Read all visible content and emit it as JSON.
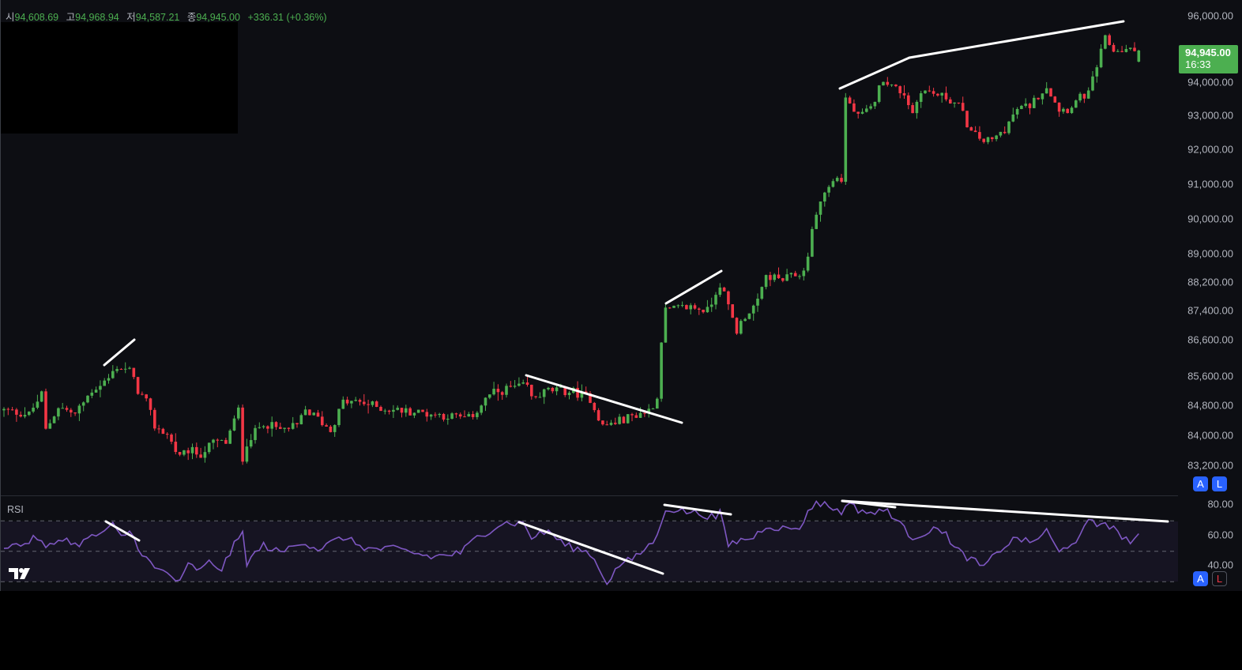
{
  "legend": {
    "open_label": "시",
    "open": "94,608.69",
    "high_label": "고",
    "high": "94,968.94",
    "low_label": "저",
    "low": "94,587.21",
    "close_label": "종",
    "close": "94,945.00",
    "change": "+336.31 (+0.36%)"
  },
  "last_price": {
    "price": "94,945.00",
    "countdown": "16:33"
  },
  "buttons": {
    "auto": "A",
    "log": "L"
  },
  "rsi_title": "RSI",
  "colors": {
    "up": "#4caf50",
    "down": "#f23645",
    "rsi": "#7e57c2",
    "background": "#0d0e13"
  },
  "chart_data": [
    {
      "type": "candlestick",
      "title": "",
      "scale": "log",
      "ylim": [
        83000,
        96200
      ],
      "price_ticks": [
        "96,000.00",
        "94,000.00",
        "93,000.00",
        "92,000.00",
        "91,000.00",
        "90,000.00",
        "89,000.00",
        "88,200.00",
        "87,400.00",
        "86,600.00",
        "85,600.00",
        "84,800.00",
        "84,000.00",
        "83,200.00"
      ],
      "price_tick_values": [
        96000,
        94000,
        93000,
        92000,
        91000,
        90000,
        89000,
        88200,
        87400,
        86600,
        85600,
        84800,
        84000,
        83200
      ],
      "bar_count": 272,
      "last_bar": {
        "open": 94608.69,
        "high": 94968.94,
        "low": 94587.21,
        "close": 94945.0
      },
      "close_path": [
        [
          0,
          84670
        ],
        [
          6,
          84560
        ],
        [
          9,
          85100
        ],
        [
          10,
          84130
        ],
        [
          13,
          84780
        ],
        [
          17,
          84560
        ],
        [
          21,
          85210
        ],
        [
          25,
          85535
        ],
        [
          27,
          85860
        ],
        [
          30,
          85750
        ],
        [
          32,
          85210
        ],
        [
          34,
          84890
        ],
        [
          36,
          84240
        ],
        [
          39,
          84020
        ],
        [
          42,
          83390
        ],
        [
          44,
          83600
        ],
        [
          47,
          83500
        ],
        [
          50,
          83810
        ],
        [
          53,
          83810
        ],
        [
          56,
          84670
        ],
        [
          57,
          83390
        ],
        [
          58,
          83810
        ],
        [
          62,
          84350
        ],
        [
          66,
          84130
        ],
        [
          70,
          84240
        ],
        [
          72,
          84670
        ],
        [
          75,
          84450
        ],
        [
          78,
          84130
        ],
        [
          81,
          84890
        ],
        [
          85,
          84890
        ],
        [
          91,
          84710
        ],
        [
          98,
          84630
        ],
        [
          106,
          84520
        ],
        [
          111,
          84450
        ],
        [
          113,
          84670
        ],
        [
          116,
          85100
        ],
        [
          121,
          85275
        ],
        [
          125,
          85320
        ],
        [
          126,
          84990
        ],
        [
          130,
          85210
        ],
        [
          136,
          85170
        ],
        [
          140,
          84990
        ],
        [
          143,
          84240
        ],
        [
          146,
          84350
        ],
        [
          151,
          84560
        ],
        [
          154,
          84670
        ],
        [
          156,
          84990
        ],
        [
          157,
          86620
        ],
        [
          158,
          87400
        ],
        [
          164,
          87510
        ],
        [
          168,
          87400
        ],
        [
          171,
          88160
        ],
        [
          173,
          87510
        ],
        [
          175,
          86840
        ],
        [
          177,
          87270
        ],
        [
          180,
          87620
        ],
        [
          182,
          88370
        ],
        [
          186,
          88260
        ],
        [
          191,
          88480
        ],
        [
          192,
          89020
        ],
        [
          194,
          90180
        ],
        [
          196,
          90750
        ],
        [
          199,
          91210
        ],
        [
          200,
          91090
        ],
        [
          201,
          93530
        ],
        [
          204,
          92950
        ],
        [
          207,
          93190
        ],
        [
          210,
          94120
        ],
        [
          212,
          93880
        ],
        [
          215,
          93650
        ],
        [
          217,
          93070
        ],
        [
          219,
          93770
        ],
        [
          222,
          93650
        ],
        [
          225,
          93530
        ],
        [
          228,
          93300
        ],
        [
          231,
          92490
        ],
        [
          234,
          92260
        ],
        [
          236,
          92260
        ],
        [
          239,
          92600
        ],
        [
          242,
          93190
        ],
        [
          245,
          93300
        ],
        [
          249,
          93880
        ],
        [
          252,
          93190
        ],
        [
          254,
          93190
        ],
        [
          257,
          93530
        ],
        [
          259,
          93650
        ],
        [
          261,
          94470
        ],
        [
          263,
          95300
        ],
        [
          265,
          94950
        ],
        [
          268,
          94950
        ],
        [
          271,
          94945
        ]
      ]
    },
    {
      "type": "line",
      "title": "RSI",
      "ylim": [
        26,
        84
      ],
      "ticks": [
        "80.00",
        "60.00",
        "40.00"
      ],
      "tick_values": [
        80,
        60,
        40
      ],
      "bands": [
        70,
        50,
        30
      ],
      "rsi_path": [
        [
          0,
          53
        ],
        [
          4,
          53
        ],
        [
          8,
          58.2
        ],
        [
          10,
          50.4
        ],
        [
          14,
          58.2
        ],
        [
          17,
          53
        ],
        [
          21,
          58.2
        ],
        [
          25,
          63.4
        ],
        [
          26,
          66
        ],
        [
          28,
          58.2
        ],
        [
          30,
          62.3
        ],
        [
          33,
          47.8
        ],
        [
          36,
          37.4
        ],
        [
          39,
          34.8
        ],
        [
          42,
          28
        ],
        [
          44,
          40
        ],
        [
          47,
          36.4
        ],
        [
          49,
          41.6
        ],
        [
          52,
          37.4
        ],
        [
          55,
          53
        ],
        [
          57,
          60.8
        ],
        [
          58,
          41.6
        ],
        [
          62,
          53
        ],
        [
          66,
          47.8
        ],
        [
          71,
          55.6
        ],
        [
          75,
          50.4
        ],
        [
          81,
          58.2
        ],
        [
          87,
          50.4
        ],
        [
          94,
          50.4
        ],
        [
          102,
          45.2
        ],
        [
          109,
          47.8
        ],
        [
          113,
          58.2
        ],
        [
          119,
          67.5
        ],
        [
          124,
          67.5
        ],
        [
          126,
          58.2
        ],
        [
          130,
          62.3
        ],
        [
          134,
          53
        ],
        [
          140,
          47.8
        ],
        [
          144,
          28.6
        ],
        [
          147,
          40
        ],
        [
          151,
          45.2
        ],
        [
          154,
          53
        ],
        [
          156,
          58.2
        ],
        [
          158,
          77.4
        ],
        [
          160,
          76.4
        ],
        [
          166,
          73.8
        ],
        [
          170,
          71.2
        ],
        [
          171,
          73.8
        ],
        [
          173,
          53
        ],
        [
          175,
          55.6
        ],
        [
          179,
          58.2
        ],
        [
          182,
          66
        ],
        [
          187,
          63.4
        ],
        [
          191,
          66
        ],
        [
          192,
          76.4
        ],
        [
          194,
          81
        ],
        [
          197,
          79
        ],
        [
          200,
          73.8
        ],
        [
          201,
          81
        ],
        [
          204,
          76.4
        ],
        [
          208,
          73.8
        ],
        [
          211,
          76.4
        ],
        [
          215,
          63.4
        ],
        [
          217,
          58.2
        ],
        [
          221,
          62.3
        ],
        [
          225,
          63.4
        ],
        [
          226,
          53
        ],
        [
          230,
          45.2
        ],
        [
          234,
          38.4
        ],
        [
          238,
          50.4
        ],
        [
          242,
          58.2
        ],
        [
          245,
          54
        ],
        [
          249,
          62.3
        ],
        [
          252,
          47.8
        ],
        [
          254,
          53
        ],
        [
          257,
          58.2
        ],
        [
          259,
          68.6
        ],
        [
          261,
          66
        ],
        [
          263,
          68.6
        ],
        [
          266,
          60.8
        ],
        [
          269,
          55.6
        ],
        [
          271,
          58.2
        ]
      ]
    }
  ]
}
